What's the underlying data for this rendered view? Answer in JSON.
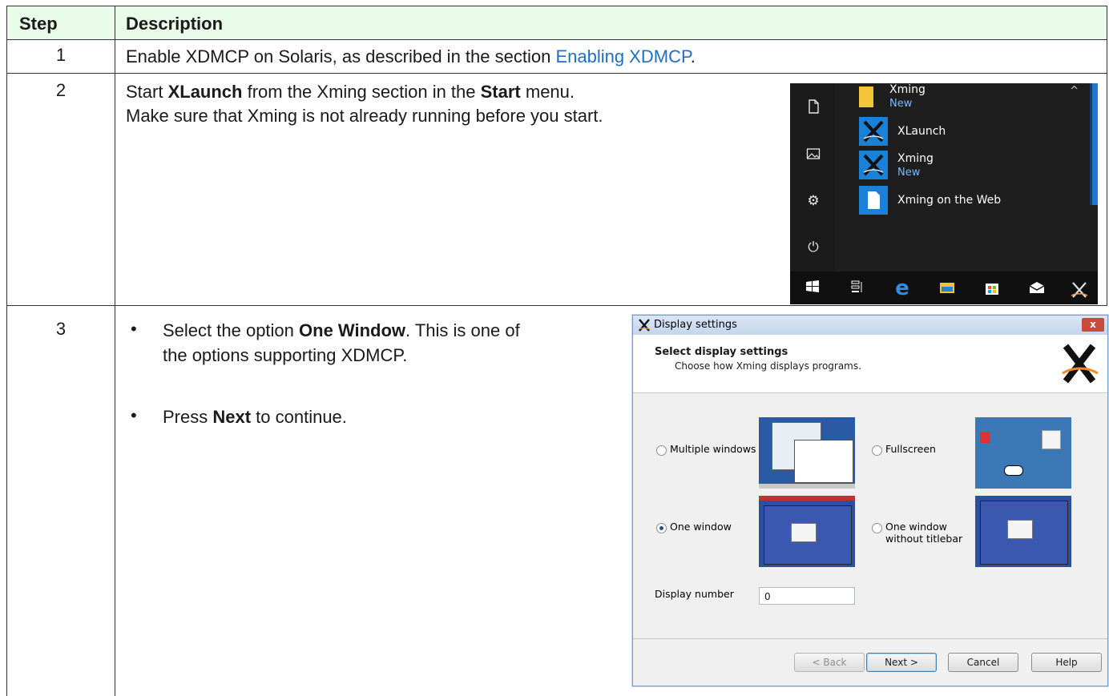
{
  "table": {
    "headers": {
      "step": "Step",
      "description": "Description"
    },
    "rows": [
      {
        "step": "1",
        "text_before": "Enable XDMCP on Solaris, as described in the section ",
        "link": "Enabling XDMCP",
        "text_after": "."
      },
      {
        "step": "2",
        "line1_a": "Start ",
        "line1_bold1": "XLaunch",
        "line1_b": " from the Xming section in the ",
        "line1_bold2": "Start",
        "line1_c": " menu.",
        "line2": "Make sure that Xming is not already running before you start."
      },
      {
        "step": "3",
        "bullet1_a": "Select the option ",
        "bullet1_bold": "One Window",
        "bullet1_b": ". This is one of",
        "bullet1_line2": "the options supporting XDMCP.",
        "bullet2_a": "Press ",
        "bullet2_bold": "Next",
        "bullet2_b": " to continue."
      }
    ]
  },
  "start_menu": {
    "group": {
      "label": "Xming",
      "sub": "New"
    },
    "items": [
      {
        "label": "XLaunch",
        "sub": "",
        "icon": "xming-icon"
      },
      {
        "label": "Xming",
        "sub": "New",
        "icon": "xming-icon"
      },
      {
        "label": "Xming on the Web",
        "sub": "",
        "icon": "document-icon"
      }
    ],
    "rail_icons": [
      "document-icon",
      "pictures-icon",
      "settings-icon",
      "power-icon"
    ],
    "taskbar_icons": [
      "windows-start-icon",
      "task-view-icon",
      "edge-icon",
      "file-explorer-icon",
      "store-icon",
      "mail-icon",
      "xming-icon"
    ]
  },
  "dialog": {
    "title": "Display settings",
    "heading": "Select display settings",
    "subheading": "Choose how Xming displays programs.",
    "options": [
      {
        "label": "Multiple windows",
        "selected": false
      },
      {
        "label": "Fullscreen",
        "selected": false
      },
      {
        "label": "One window",
        "selected": true
      },
      {
        "label_line1": "One window",
        "label_line2": "without titlebar",
        "selected": false
      }
    ],
    "display_number_label": "Display number",
    "display_number_value": "0",
    "buttons": {
      "back": "< Back",
      "next": "Next >",
      "cancel": "Cancel",
      "help": "Help"
    },
    "close_symbol": "x"
  },
  "colors": {
    "header_bg": "#e9fbe9",
    "link": "#1f6fc0",
    "start_tile": "#1a80d8"
  }
}
